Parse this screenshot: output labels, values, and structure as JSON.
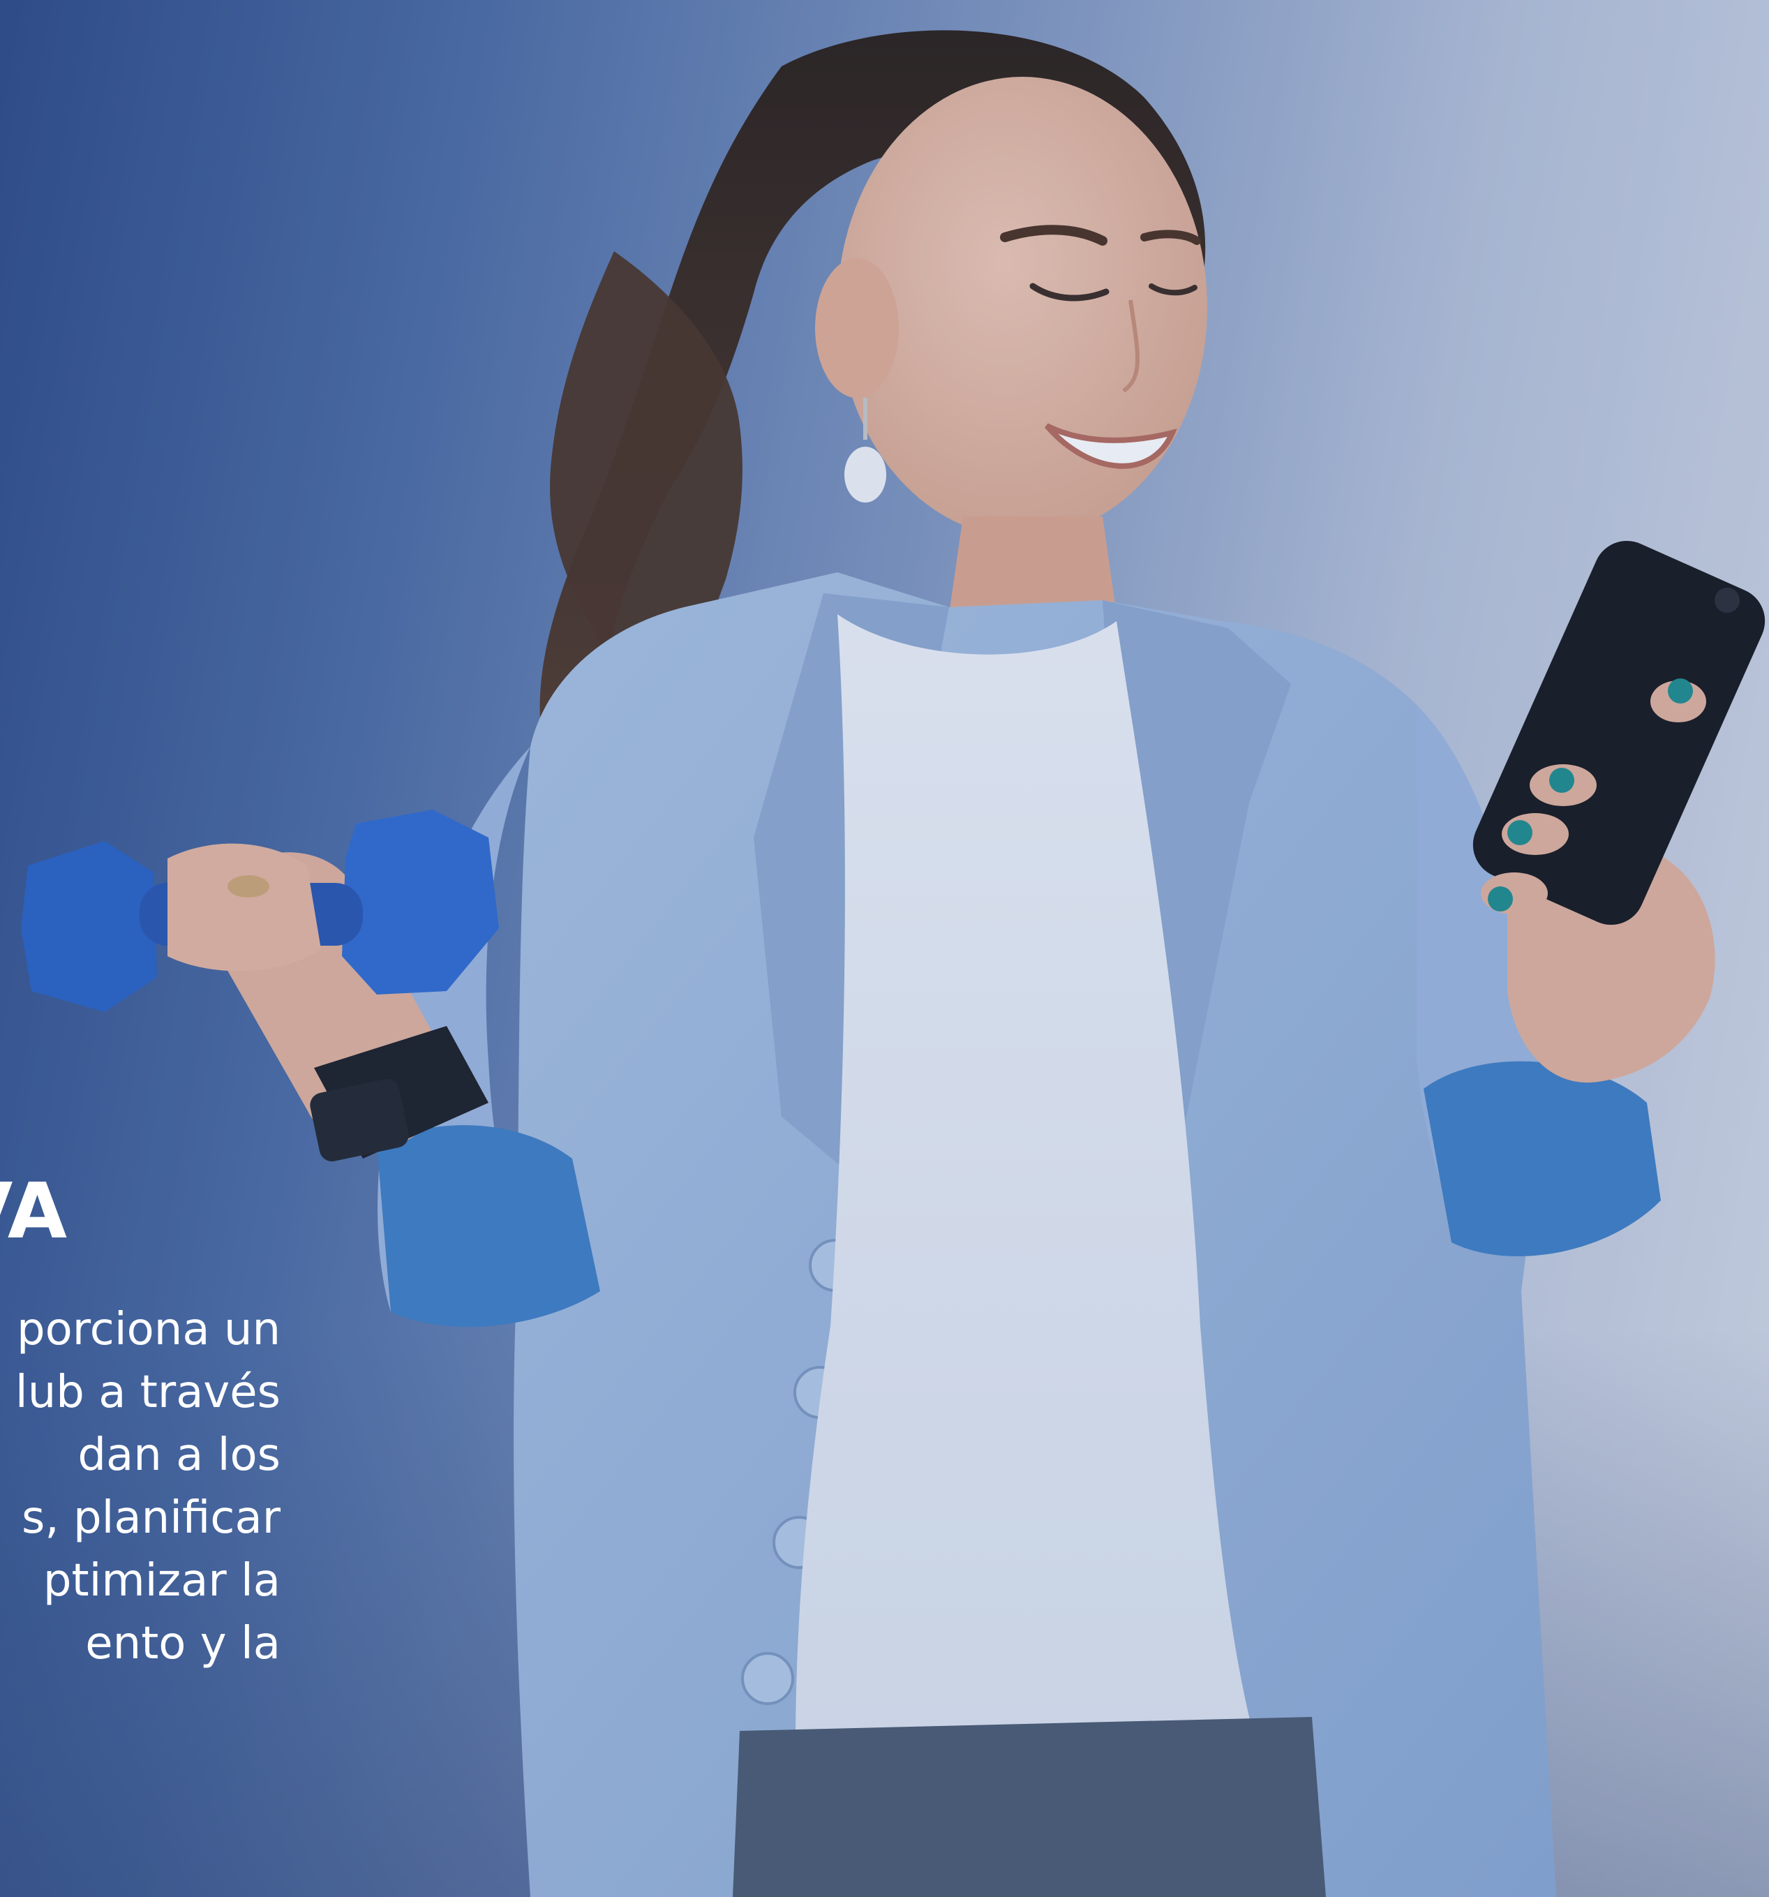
{
  "hero": {
    "heading_visible_fragment": "VA",
    "body_visible_lines": [
      "porciona un",
      "lub a través",
      "dan a los",
      "s, planificar",
      "ptimizar la",
      "ento y la"
    ]
  },
  "photo": {
    "subject": "smiling woman holding blue dumbbell and smartphone",
    "colors": {
      "background_left": "#2d4a85",
      "background_right": "#d6dbe6",
      "jacket": "#9fb9dc",
      "jacket_cuff": "#3f7fc4",
      "shirt": "#e6ebf3",
      "dumbbell": "#2a62c4",
      "hair": "#3a2a20",
      "skin": "#e8b9a1",
      "phone": "#15171c",
      "jeans": "#4b5a70",
      "nails": "#1f8c8c"
    },
    "icons": [
      "dumbbell-icon",
      "smartphone-icon",
      "smartwatch-icon"
    ]
  }
}
